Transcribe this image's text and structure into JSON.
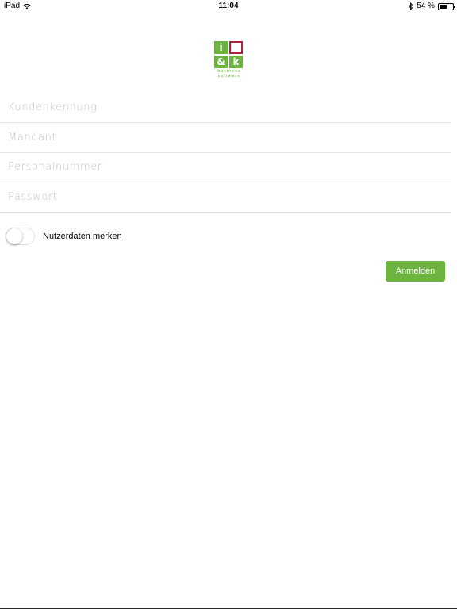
{
  "status_bar": {
    "device": "iPad",
    "time": "11:04",
    "battery_text": "54 %",
    "battery_level": 0.54
  },
  "logo": {
    "cells": [
      "i",
      "",
      "&",
      "k"
    ],
    "line1": "business",
    "line2": "software"
  },
  "form": {
    "fields": [
      {
        "placeholder": "Kundenkennung"
      },
      {
        "placeholder": "Mandant"
      },
      {
        "placeholder": "Personalnummer"
      },
      {
        "placeholder": "Passwort"
      }
    ],
    "remember_label": "Nutzerdaten merken",
    "remember_on": false,
    "submit_label": "Anmelden"
  },
  "colors": {
    "brand_green": "#6cb33f",
    "brand_red": "#a8263b",
    "divider": "#e3e3e3",
    "placeholder": "#c4c4c4"
  }
}
